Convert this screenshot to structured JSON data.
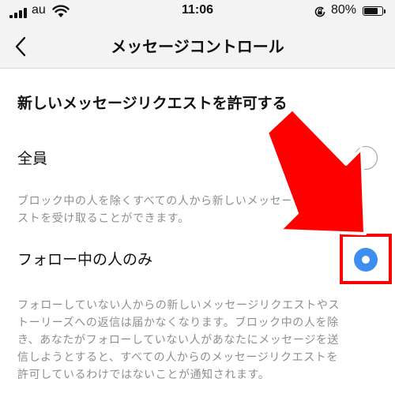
{
  "status_bar": {
    "carrier": "au",
    "time": "11:06",
    "battery_percent": "80%",
    "battery_level": 0.8
  },
  "nav": {
    "title": "メッセージコントロール"
  },
  "section": {
    "heading": "新しいメッセージリクエストを許可する"
  },
  "options": [
    {
      "label": "全員",
      "selected": false,
      "description_lines": [
        "ブロック中の人を除くすべての人から新しいメッセージリクエ",
        "ストを受け取ることができます。"
      ]
    },
    {
      "label": "フォロー中の人のみ",
      "selected": true,
      "description_lines": [
        "フォローしていない人からの新しいメッセージリクエストやス",
        "トーリーズへの返信は届かなくなります。ブロック中の人を除",
        "き、あなたがフォローしていない人があなたにメッセージを送",
        "信しようとすると、すべての人からのメッセージリクエストを",
        "許可しているわけではないことが通知されます。"
      ]
    }
  ],
  "colors": {
    "accent": "#3d8ef0",
    "annotation": "#ff0000",
    "secondary_text": "#8e8e8e",
    "bar_background": "#f3f3f3"
  },
  "icons": {
    "back": "chevron-left-icon",
    "signal": "cellular-signal-icon",
    "wifi": "wifi-icon",
    "rotation_lock": "rotation-lock-icon",
    "battery": "battery-icon",
    "annotation_arrow": "arrow-icon"
  }
}
